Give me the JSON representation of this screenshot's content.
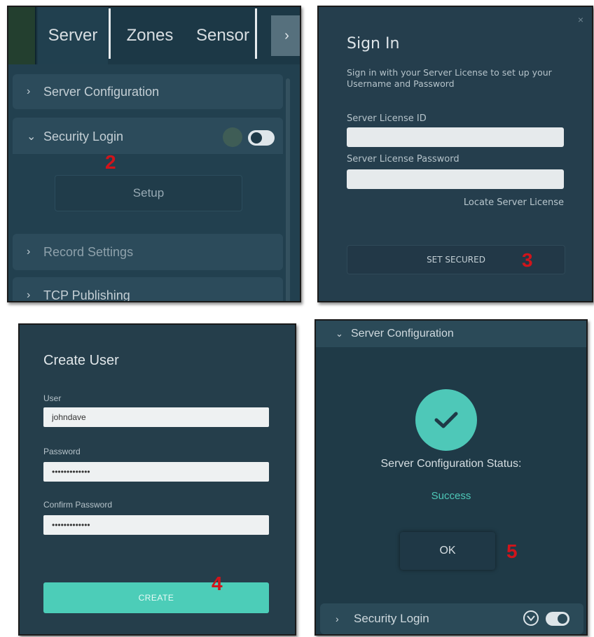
{
  "panel1": {
    "tabs": [
      "Server",
      "Zones",
      "Sensor"
    ],
    "next_icon": "chevron-right-icon",
    "sections": {
      "server_config": "Server Configuration",
      "security_login": "Security Login",
      "record_settings": "Record Settings",
      "tcp_publishing": "TCP Publishing"
    },
    "setup_label": "Setup",
    "step_number": "2",
    "toggle_on": true
  },
  "panel2": {
    "title": "Sign In",
    "subtitle": "Sign in with your Server License to set up your Username and Password",
    "license_id_label": "Server License ID",
    "license_id_value": "",
    "license_password_label": "Server License Password",
    "license_password_value": "",
    "locate_link": "Locate Server License",
    "button_label": "SET SECURED",
    "step_number": "3",
    "close_icon": "close-icon"
  },
  "panel3": {
    "title": "Create User",
    "user_label": "User",
    "user_value": "johndave",
    "password_label": "Password",
    "password_value": "•••••••••••••",
    "confirm_label": "Confirm Password",
    "confirm_value": "•••••••••••••",
    "button_label": "CREATE",
    "step_number": "4"
  },
  "panel4": {
    "header": "Server Configuration",
    "status_label": "Server Configuration Status:",
    "status_value": "Success",
    "ok_label": "OK",
    "footer": "Security Login",
    "step_number": "5",
    "accent_color": "#4ec8b8"
  }
}
